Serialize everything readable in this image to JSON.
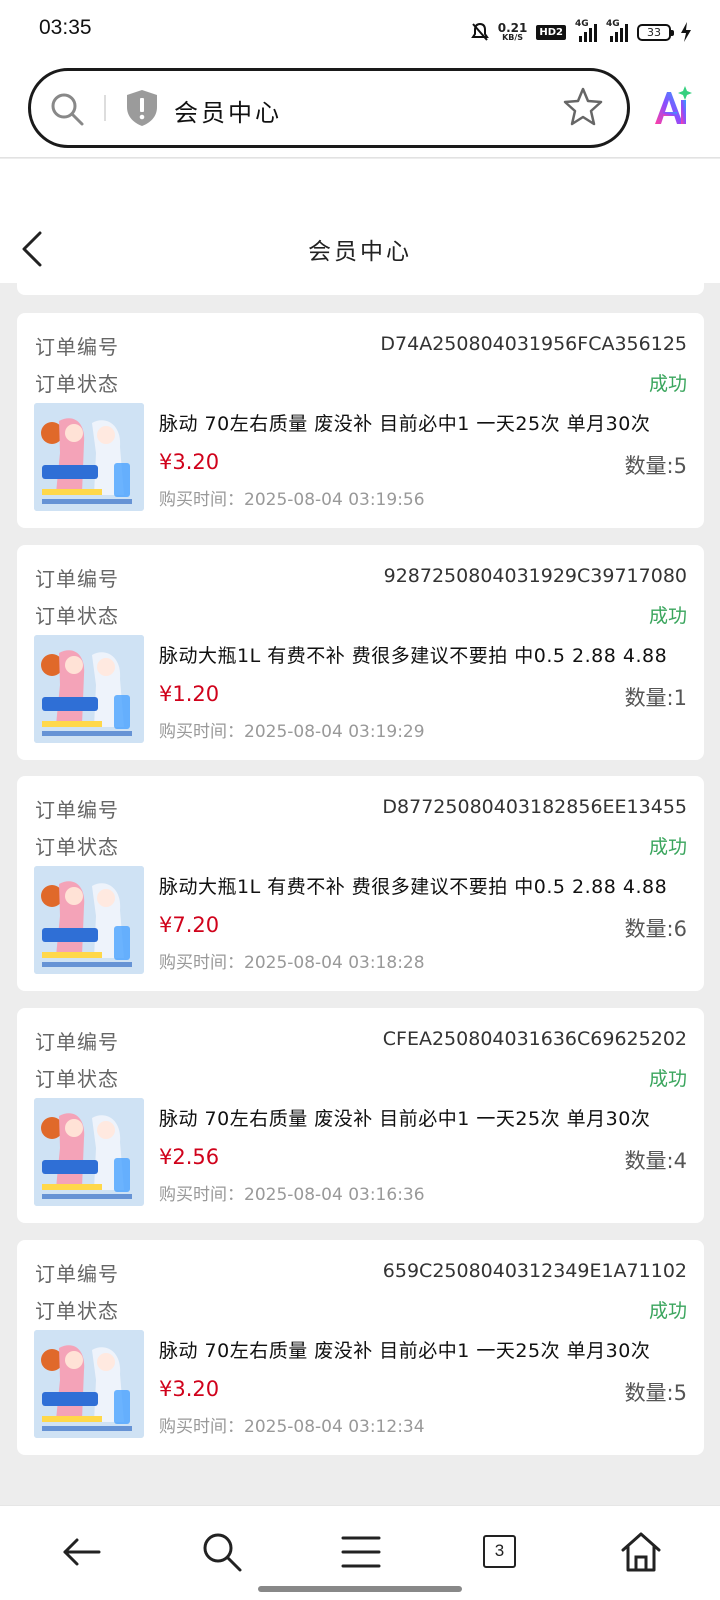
{
  "status_bar": {
    "time": "03:35",
    "net_speed_value": "0.21",
    "net_speed_unit": "KB/S",
    "hd_label": "HD2",
    "sim1_label": "4G",
    "sim2_label": "4G",
    "battery": "33"
  },
  "address_bar": {
    "text": "会员中心",
    "icons": [
      "search-icon",
      "shield-icon",
      "star-icon",
      "ai-icon"
    ]
  },
  "header": {
    "title": "会员中心"
  },
  "labels": {
    "order_no": "订单编号",
    "order_status": "订单状态"
  },
  "orders": [
    {
      "order_no": "D74A250804031956FCA356125",
      "status": "成功",
      "product": "脉动 70左右质量 废没补 目前必中1 一天25次 单月30次",
      "price": "¥3.20",
      "quantity": "数量:5",
      "purchase_time": "购买时间：2025-08-04 03:19:56"
    },
    {
      "order_no": "9287250804031929C39717080",
      "status": "成功",
      "product": "脉动大瓶1L 有费不补 费很多建议不要拍 中0.5 2.88 4.88",
      "price": "¥1.20",
      "quantity": "数量:1",
      "purchase_time": "购买时间：2025-08-04 03:19:29"
    },
    {
      "order_no": "D87725080403182856EE13455",
      "status": "成功",
      "product": "脉动大瓶1L 有费不补 费很多建议不要拍 中0.5 2.88 4.88",
      "price": "¥7.20",
      "quantity": "数量:6",
      "purchase_time": "购买时间：2025-08-04 03:18:28"
    },
    {
      "order_no": "CFEA250804031636C69625202",
      "status": "成功",
      "product": "脉动 70左右质量 废没补 目前必中1 一天25次 单月30次",
      "price": "¥2.56",
      "quantity": "数量:4",
      "purchase_time": "购买时间：2025-08-04 03:16:36"
    },
    {
      "order_no": "659C2508040312349E1A71102",
      "status": "成功",
      "product": "脉动 70左右质量 废没补 目前必中1 一天25次 单月30次",
      "price": "¥3.20",
      "quantity": "数量:5",
      "purchase_time": "购买时间：2025-08-04 03:12:34"
    }
  ],
  "bottom_nav": {
    "tab_count": "3",
    "icons": [
      "back-arrow-icon",
      "search-icon",
      "menu-icon",
      "tabs-icon",
      "home-icon"
    ]
  },
  "colors": {
    "success": "#3aa55d",
    "price": "#d0021b",
    "background": "#ededed"
  }
}
